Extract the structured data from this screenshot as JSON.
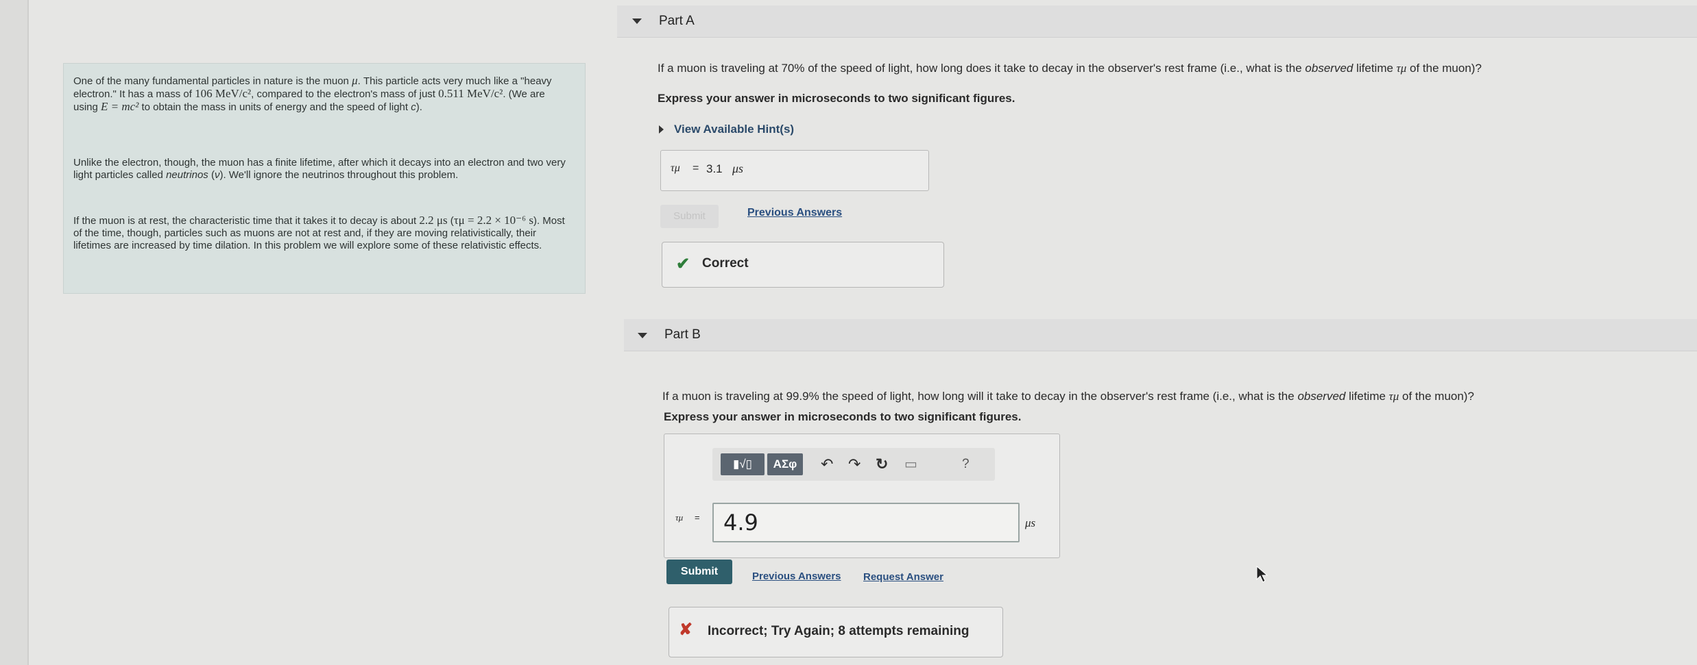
{
  "intro": {
    "p1_a": "One of the many fundamental particles in nature is the muon ",
    "mu": "μ",
    "p1_b": ". This particle acts very much like a \"heavy electron.\" It has a mass of ",
    "mass_muon": "106 MeV/c²",
    "p1_c": ", compared to the electron's mass of just ",
    "mass_electron": "0.511 MeV/c²",
    "p1_d": ". (We are using ",
    "emc2": "E = mc²",
    "p1_e": " to obtain the mass in units of energy and the speed of light ",
    "c": "c",
    "p1_f": ").",
    "p2_a": "Unlike the electron, though, the muon has a finite lifetime, after which it decays into an electron and two very light particles called ",
    "neutrinos": "neutrinos",
    "p2_b": " (",
    "nu": "ν",
    "p2_c": "). We'll ignore the neutrinos throughout this problem.",
    "p3_a": "If the muon is at rest, the characteristic time that it takes it to decay is about ",
    "rest_time": "2.2 μs",
    "p3_b": " (",
    "tau_expr": "τμ = 2.2 × 10⁻⁶ s",
    "p3_c": "). Most of the time, though, particles such as muons are not at rest and, if they are moving relativistically, their lifetimes are increased by time dilation. In this problem we will explore some of these relativistic effects."
  },
  "part_a": {
    "title": "Part A",
    "question_a": "If a muon is traveling at 70% of the speed of light, how long does it take to decay in the observer's rest frame (i.e., what is the ",
    "observed": "observed",
    "question_b": " lifetime ",
    "tau": "τμ",
    "question_c": " of the muon)?",
    "instruction": "Express your answer in microseconds to two significant figures.",
    "hint_label": "View Available Hint(s)",
    "answer_var": "τμ",
    "answer_eq": "=",
    "answer_value": "3.1",
    "answer_unit": "μs",
    "submit_label": "Submit",
    "previous_answers": "Previous Answers",
    "feedback": "Correct"
  },
  "part_b": {
    "title": "Part B",
    "question_a": "If a muon is traveling at 99.9% the speed of light, how long will it take to decay in the observer's rest frame (i.e., what is the ",
    "observed": "observed",
    "question_b": " lifetime ",
    "tau": "τμ",
    "question_c": " of the muon)?",
    "instruction": "Express your answer in microseconds to two significant figures.",
    "toolbar": {
      "templates_label": "▮√▯",
      "greek_label": "ΑΣφ",
      "undo": "↶",
      "redo": "↷",
      "reset": "↻",
      "keyboard": "▭",
      "help": "?"
    },
    "answer_var": "τμ",
    "answer_eq": "=",
    "answer_value": "4.9",
    "answer_unit": "μs",
    "submit_label": "Submit",
    "previous_answers": "Previous Answers",
    "request_answer": "Request Answer",
    "feedback": "Incorrect; Try Again; 8 attempts remaining"
  }
}
